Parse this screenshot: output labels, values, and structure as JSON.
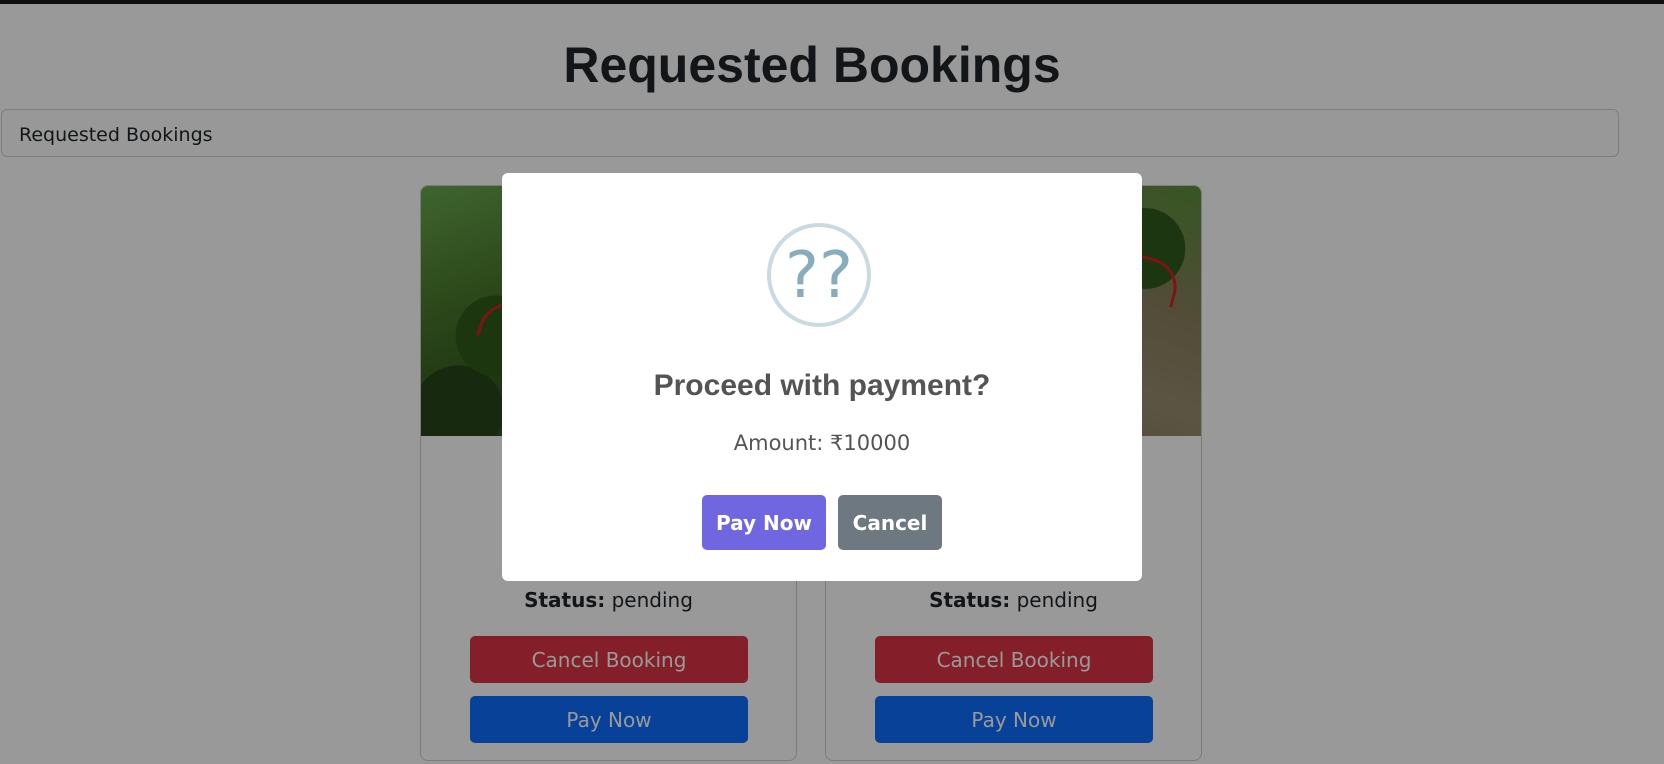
{
  "page": {
    "title": "Requested Bookings",
    "tab_label": "Requested Bookings"
  },
  "cards": [
    {
      "line_a_label": "",
      "line_b_label": "",
      "status_label": "Status:",
      "status_value": "pending",
      "cancel_label": "Cancel Booking",
      "pay_label": "Pay Now"
    },
    {
      "status_label": "Status:",
      "status_value": "pending",
      "cancel_label": "Cancel Booking",
      "pay_label": "Pay Now"
    }
  ],
  "modal": {
    "icon": "??",
    "title": "Proceed with payment?",
    "text": "Amount: ₹10000",
    "confirm_label": "Pay Now",
    "cancel_label": "Cancel"
  },
  "colors": {
    "confirm": "#7066e0",
    "cancel": "#6e7881",
    "danger": "#dc3545",
    "primary": "#0d6efd"
  }
}
